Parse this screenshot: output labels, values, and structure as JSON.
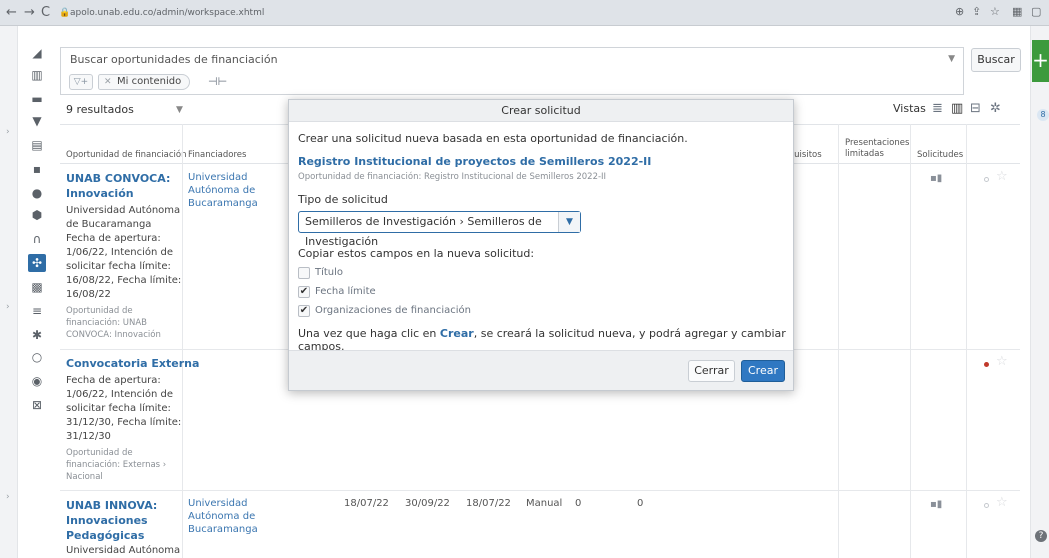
{
  "browser": {
    "url": "apolo.unab.edu.co/admin/workspace.xhtml",
    "back_icon": "arrow-left",
    "forward_icon": "arrow-right",
    "reload_icon": "reload"
  },
  "search": {
    "placeholder": "Buscar oportunidades de financiación",
    "filter_chip": "Mi contenido",
    "button": "Buscar"
  },
  "toolbar": {
    "results": "9 resultados",
    "views_label": "Vistas"
  },
  "table": {
    "headers": [
      "Oportunidad de financiación",
      "Financiadores",
      "Requisitos",
      "Presentaciones limitadas",
      "Solicitudes"
    ],
    "rows": [
      {
        "title_lines": [
          "UNAB CONVOCA:",
          "Innovación"
        ],
        "text_lines": [
          "Universidad Autónoma",
          "de Bucaramanga",
          "Fecha de apertura:",
          "1/06/22, Intención de",
          "solicitar fecha límite:",
          "16/08/22, Fecha límite:",
          "16/08/22"
        ],
        "meta_lines": [
          "Oportunidad de",
          "financiación: UNAB",
          "CONVOCA: Innovación"
        ],
        "funder_lines": [
          "Universidad",
          "Autónoma de",
          "Bucaramanga"
        ]
      },
      {
        "title_lines": [
          "Convocatoria Externa"
        ],
        "text_lines": [
          "Fecha de apertura:",
          "1/06/22, Intención de",
          "solicitar fecha límite:",
          "31/12/30, Fecha límite:",
          "31/12/30"
        ],
        "meta_lines": [
          "Oportunidad de",
          "financiación: Externas ›",
          "Nacional"
        ]
      },
      {
        "title_lines": [
          "UNAB INNOVA:",
          "Innovaciones",
          "Pedagógicas"
        ],
        "text_lines": [
          "Universidad Autónoma"
        ],
        "funder_lines": [
          "Universidad",
          "Autónoma de",
          "Bucaramanga"
        ],
        "values": [
          "18/07/22",
          "30/09/22",
          "18/07/22",
          "Manual",
          "0",
          "0"
        ]
      }
    ]
  },
  "dialog": {
    "title": "Crear solicitud",
    "intro": "Crear una solicitud nueva basada en esta oportunidad de financiación.",
    "opportunity": "Registro Institucional de proyectos de Semilleros 2022-II",
    "opportunity_sub": "Oportunidad de financiación: Registro Institucional de Semilleros 2022-II",
    "type_label": "Tipo de solicitud",
    "type_value": "Semilleros de Investigación › Semilleros de Investigación",
    "copy_label": "Copiar estos campos en la nueva solicitud:",
    "fields": [
      {
        "label": "Título",
        "checked": false
      },
      {
        "label": "Fecha límite",
        "checked": true
      },
      {
        "label": "Organizaciones de financiación",
        "checked": true
      }
    ],
    "note_before": "Una vez que haga clic en ",
    "note_bold": "Crear",
    "note_after": ", se creará la solicitud nueva, y podrá agregar y cambiar campos.",
    "close_button": "Cerrar",
    "create_button": "Crear"
  },
  "right_rail": {
    "plus": "+",
    "badge": "8",
    "help": "?"
  },
  "colors": {
    "accent": "#2f6da6",
    "primary_button": "#2f78c2",
    "green": "#3c9a3c"
  }
}
